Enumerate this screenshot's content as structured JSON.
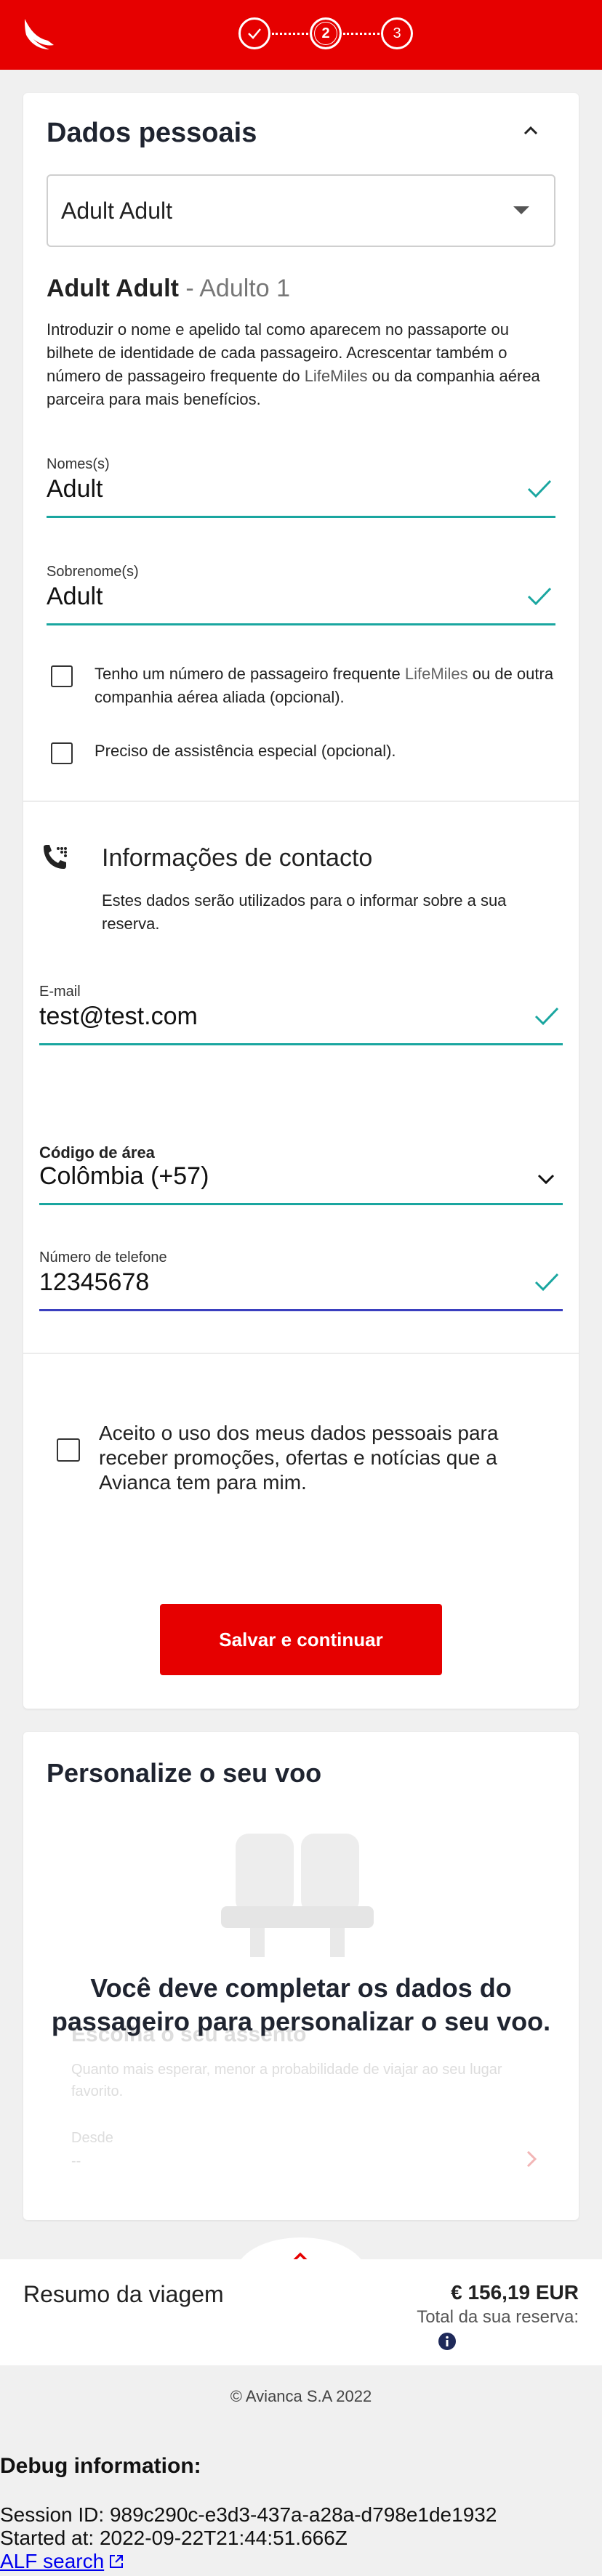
{
  "header": {
    "steps": [
      {
        "label": "",
        "state": "done",
        "icon": "check-icon"
      },
      {
        "label": "2",
        "state": "current"
      },
      {
        "label": "3",
        "state": "pending"
      }
    ],
    "brand_color": "#e60000"
  },
  "personal": {
    "title": "Dados pessoais",
    "passenger_select": "Adult Adult",
    "passenger_name": "Adult Adult",
    "passenger_type": " - Adulto 1",
    "intro_before": "Introduzir o nome e apelido tal como aparecem no passaporte ou bilhete de identidade de cada passageiro. Acrescentar também o número de passageiro frequente do ",
    "intro_brand": "LifeMiles",
    "intro_after": " ou da companhia aérea parceira para mais benefícios.",
    "first_name": {
      "label": "Nomes(s)",
      "value": "Adult"
    },
    "last_name": {
      "label": "Sobrenome(s)",
      "value": "Adult"
    },
    "ff_before": "Tenho um número de passageiro frequente ",
    "ff_brand": "LifeMiles",
    "ff_after": " ou de outra companhia aérea aliada (opcional).",
    "assist": "Preciso de assistência especial (opcional)."
  },
  "contact": {
    "title": "Informações de contacto",
    "subtitle": "Estes dados serão utilizados para o informar sobre a sua reserva.",
    "email": {
      "label": "E-mail",
      "value": "test@test.com"
    },
    "area": {
      "label": "Código de área",
      "value": "Colômbia (+57)"
    },
    "phone": {
      "label": "Número de telefone",
      "value": "12345678"
    }
  },
  "consent": "Aceito o uso dos meus dados pessoais para receber promoções, ofertas e notícias que a Avianca tem para mim.",
  "save_button": "Salvar e continuar",
  "personalize": {
    "title": "Personalize o seu voo",
    "faded_title": "Escolha o seu assento",
    "faded_sub": "Quanto mais esperar, menor a probabilidade de viajar ao seu lugar favorito.",
    "faded_desde": "Desde",
    "faded_price": "--",
    "message": "Você deve completar os dados do passageiro para personalizar o seu voo."
  },
  "summary": {
    "label": "Resumo da viagem",
    "price": "€ 156,19 EUR",
    "total_label": "Total da sua reserva:"
  },
  "footer": {
    "copyright": "© Avianca S.A 2022"
  },
  "debug": {
    "title": "Debug information:",
    "session": "Session ID: 989c290c-e3d3-437a-a28a-d798e1de1932",
    "started": "Started at: 2022-09-22T21:44:51.666Z",
    "link": "ALF search"
  }
}
